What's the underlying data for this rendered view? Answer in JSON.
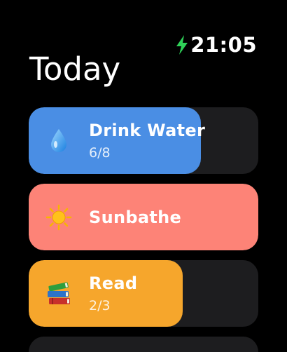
{
  "status_bar": {
    "time": "21:05",
    "charging_icon": "lightning-bolt-icon",
    "charging_color": "#2fd158"
  },
  "page": {
    "title": "Today"
  },
  "habits": [
    {
      "name": "Drink Water",
      "progress_text": "6/8",
      "progress": 0.75,
      "icon": "water-drop-icon",
      "color": "#4a8ee4"
    },
    {
      "name": "Sunbathe",
      "progress_text": "",
      "progress": 1.0,
      "icon": "sun-icon",
      "color": "#fd8377"
    },
    {
      "name": "Read",
      "progress_text": "2/3",
      "progress": 0.67,
      "icon": "books-icon",
      "color": "#f6a62c"
    }
  ],
  "colors": {
    "background": "#000000",
    "track": "#1d1d1f"
  }
}
